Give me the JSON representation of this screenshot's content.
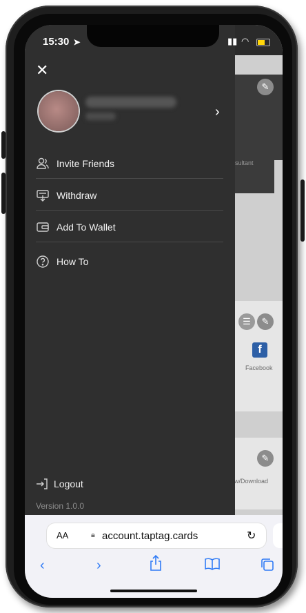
{
  "status": {
    "time": "15:30"
  },
  "drawer": {
    "close_label": "✕",
    "menu": [
      {
        "label": "Invite Friends",
        "icon": "users-icon"
      },
      {
        "label": "Withdraw",
        "icon": "withdraw-icon"
      },
      {
        "label": "Add To Wallet",
        "icon": "wallet-icon"
      },
      {
        "label": "How To",
        "icon": "help-icon"
      }
    ],
    "logout_label": "Logout",
    "version": "Version 1.0.0"
  },
  "background_page": {
    "labels": {
      "consultant": "nsultant",
      "facebook": "Facebook",
      "download": "w/Download"
    }
  },
  "safari": {
    "text_size": "AA",
    "url": "account.taptag.cards"
  },
  "colors": {
    "accent": "#2f7bf6",
    "drawer_bg": "#2f2f2f",
    "battery": "#ffd60a"
  }
}
